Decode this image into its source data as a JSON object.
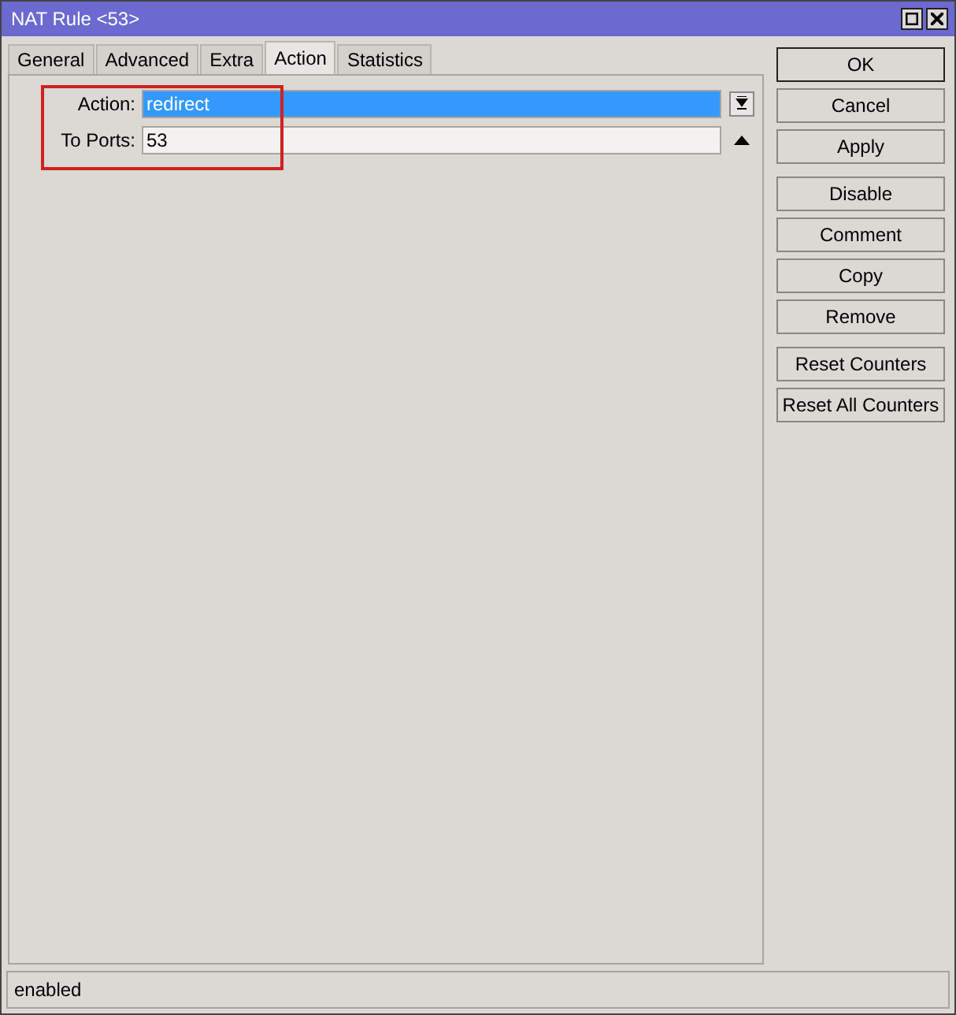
{
  "window": {
    "title": "NAT Rule <53>"
  },
  "tabs": [
    {
      "label": "General",
      "selected": false
    },
    {
      "label": "Advanced",
      "selected": false
    },
    {
      "label": "Extra",
      "selected": false
    },
    {
      "label": "Action",
      "selected": true
    },
    {
      "label": "Statistics",
      "selected": false
    }
  ],
  "fields": [
    {
      "label": "Action:",
      "value": "redirect",
      "kind": "dropdown",
      "selected": true
    },
    {
      "label": "To Ports:",
      "value": "53",
      "kind": "text",
      "selected": false
    }
  ],
  "button_groups": [
    [
      {
        "label": "OK",
        "default": true
      },
      {
        "label": "Cancel",
        "default": false
      },
      {
        "label": "Apply",
        "default": false
      }
    ],
    [
      {
        "label": "Disable",
        "default": false
      },
      {
        "label": "Comment",
        "default": false
      },
      {
        "label": "Copy",
        "default": false
      },
      {
        "label": "Remove",
        "default": false
      }
    ],
    [
      {
        "label": "Reset Counters",
        "default": false
      },
      {
        "label": "Reset All Counters",
        "default": false
      }
    ]
  ],
  "status_bar": {
    "text": "enabled"
  }
}
